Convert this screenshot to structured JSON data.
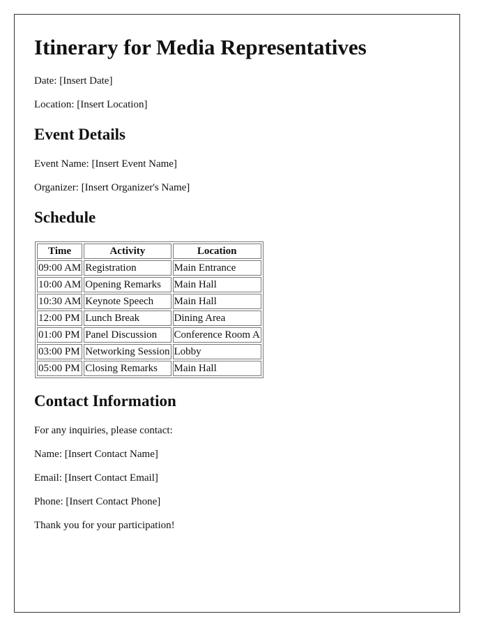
{
  "title": "Itinerary for Media Representatives",
  "intro": {
    "date": "Date: [Insert Date]",
    "location": "Location: [Insert Location]"
  },
  "event_details": {
    "heading": "Event Details",
    "event_name": "Event Name: [Insert Event Name]",
    "organizer": "Organizer: [Insert Organizer's Name]"
  },
  "schedule": {
    "heading": "Schedule",
    "columns": [
      "Time",
      "Activity",
      "Location"
    ],
    "rows": [
      [
        "09:00 AM",
        "Registration",
        "Main Entrance"
      ],
      [
        "10:00 AM",
        "Opening Remarks",
        "Main Hall"
      ],
      [
        "10:30 AM",
        "Keynote Speech",
        "Main Hall"
      ],
      [
        "12:00 PM",
        "Lunch Break",
        "Dining Area"
      ],
      [
        "01:00 PM",
        "Panel Discussion",
        "Conference Room A"
      ],
      [
        "03:00 PM",
        "Networking Session",
        "Lobby"
      ],
      [
        "05:00 PM",
        "Closing Remarks",
        "Main Hall"
      ]
    ]
  },
  "contact": {
    "heading": "Contact Information",
    "intro": "For any inquiries, please contact:",
    "name": "Name: [Insert Contact Name]",
    "email": "Email: [Insert Contact Email]",
    "phone": "Phone: [Insert Contact Phone]",
    "closing": "Thank you for your participation!"
  }
}
